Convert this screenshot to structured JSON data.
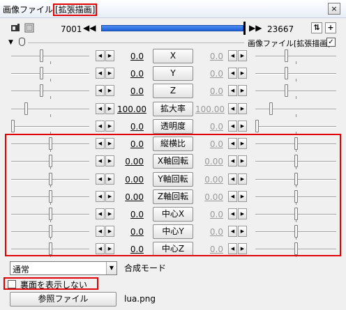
{
  "window": {
    "title_prefix": "画像ファイル",
    "title_highlight": "[拡張描画]",
    "close_glyph": "×"
  },
  "toolbar": {
    "start_frame": "7001",
    "end_frame": "23667",
    "prev_glyph": "◀◀",
    "next_glyph": "▶▶",
    "timeline_fill": 1.0
  },
  "object": {
    "name": "画像ファイル[拡張描画]",
    "enabled_glyph": "✓"
  },
  "params": [
    {
      "label": "X",
      "start": "0.0",
      "end": "0.0",
      "ls": 0.38,
      "rs": 0.38
    },
    {
      "label": "Y",
      "start": "0.0",
      "end": "0.0",
      "ls": 0.38,
      "rs": 0.38
    },
    {
      "label": "Z",
      "start": "0.0",
      "end": "0.0",
      "ls": 0.38,
      "rs": 0.38
    },
    {
      "label": "拡大率",
      "start": "100.00",
      "end": "100.00",
      "ls": 0.18,
      "rs": 0.18
    },
    {
      "label": "透明度",
      "start": "0.0",
      "end": "0.0",
      "ls": 0.0,
      "rs": 0.0
    },
    {
      "label": "縦横比",
      "start": "0.0",
      "end": "0.0",
      "ls": 0.5,
      "rs": 0.5
    },
    {
      "label": "X軸回転",
      "start": "0.00",
      "end": "0.00",
      "ls": 0.5,
      "rs": 0.5
    },
    {
      "label": "Y軸回転",
      "start": "0.00",
      "end": "0.00",
      "ls": 0.5,
      "rs": 0.5
    },
    {
      "label": "Z軸回転",
      "start": "0.00",
      "end": "0.00",
      "ls": 0.5,
      "rs": 0.5
    },
    {
      "label": "中心X",
      "start": "0.0",
      "end": "0.0",
      "ls": 0.5,
      "rs": 0.5
    },
    {
      "label": "中心Y",
      "start": "0.0",
      "end": "0.0",
      "ls": 0.5,
      "rs": 0.5
    },
    {
      "label": "中心Z",
      "start": "0.0",
      "end": "0.0",
      "ls": 0.5,
      "rs": 0.5
    }
  ],
  "blend": {
    "value": "通常",
    "label": "合成モード"
  },
  "backface": {
    "label": "裏面を表示しない",
    "checked": false
  },
  "reference": {
    "button_label": "参照ファイル",
    "file_name": "lua.png"
  },
  "colors": {
    "highlight": "#e00000",
    "timeline": "#2a6ee0"
  }
}
